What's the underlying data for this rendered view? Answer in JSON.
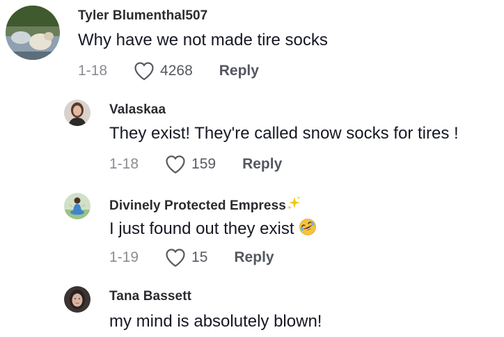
{
  "comments": [
    {
      "username": "Tyler Blumenthal507",
      "text": "Why have we not made tire socks",
      "date": "1-18",
      "likes": "4268",
      "reply_label": "Reply"
    },
    {
      "username": "Valaskaa",
      "text": "They exist! They're called snow socks for tires !",
      "date": "1-18",
      "likes": "159",
      "reply_label": "Reply"
    },
    {
      "username": "Divinely Protected Empress",
      "username_emoji": "sparkles-icon",
      "text": "I just found out they exist",
      "text_emoji": "rolling-on-floor-laughing-icon",
      "date": "1-19",
      "likes": "15",
      "reply_label": "Reply"
    },
    {
      "username": "Tana Bassett",
      "text": "my mind is absolutely blown!"
    }
  ],
  "colors": {
    "text": "#161823",
    "secondary": "#8a8b91",
    "reply": "#545760",
    "sparkle": "#f5c518"
  }
}
